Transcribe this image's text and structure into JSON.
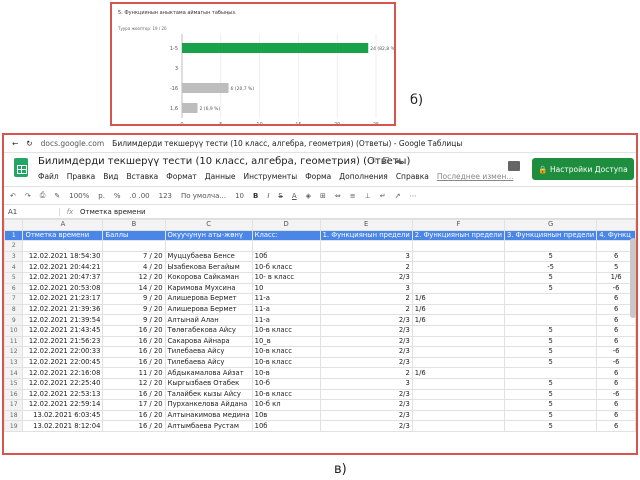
{
  "chart_panel": {
    "question": "5. Функциянын аныктама аймагын табыңыз.",
    "summary": "Туура жооптор: 19 / 20"
  },
  "chart_data": {
    "type": "bar",
    "orientation": "horizontal",
    "categories": [
      "1-5",
      "3",
      "-16",
      "1,6"
    ],
    "values": [
      24,
      0,
      6,
      2
    ],
    "data_labels": [
      "24 (82,8 %)",
      "",
      "6 (20,7 %)",
      "2 (6,9 %)"
    ],
    "xlim": [
      0,
      25
    ],
    "xticks": [
      "0",
      "5",
      "10",
      "15",
      "20",
      "25"
    ],
    "colors": {
      "correct": "#18a34a",
      "incorrect": "#bdbdbd"
    },
    "correct_index": 0
  },
  "captions": {
    "b": "б)",
    "v": "в)"
  },
  "browser": {
    "url": "docs.google.com",
    "tab_title": "Билимдерди текшерүү тести (10 класс, алгебра, геометрия) (Ответы) - Google Таблицы"
  },
  "doc": {
    "title": "Билимдерди текшерүү тести (10 класс, алгебра, геометрия) (Ответы)",
    "menus": [
      "Файл",
      "Правка",
      "Вид",
      "Вставка",
      "Формат",
      "Данные",
      "Инструменты",
      "Форма",
      "Дополнения",
      "Справка"
    ],
    "last_edit": "Последнее измен...",
    "share_label": "Настройки Доступа"
  },
  "toolbar": {
    "zoom": "100%",
    "currency": "р.",
    "percent": "%",
    "decimals": ".0  .00",
    "format": "123",
    "font": "По умолча...",
    "font_size": "10",
    "bold": "B",
    "italic": "I",
    "strike": "S",
    "text_color": "A"
  },
  "formula": {
    "cell_ref": "A1",
    "fx": "fx",
    "content": "Отметка времени"
  },
  "columns": [
    "A",
    "B",
    "C",
    "D",
    "E",
    "F",
    "G"
  ],
  "headers": [
    "Отметка времени",
    "Баллы",
    "Окуучунун аты-жөнү",
    "Класс:",
    "1. Функциянын предели",
    "2. Функциянын предели",
    "3. Функциянын предели",
    "4. Функц"
  ],
  "rows": [
    [
      "",
      "",
      "",
      "",
      "",
      "",
      "",
      ""
    ],
    [
      "12.02.2021 18:54:30",
      "7 / 20",
      "Муццубаева Бенсе",
      "10б",
      "3",
      "",
      "5",
      "6"
    ],
    [
      "12.02.2021 20:44:21",
      "4 / 20",
      "Ызабекова Бегайым",
      "10-б класс",
      "2",
      "",
      "-5",
      "5"
    ],
    [
      "12.02.2021 20:47:37",
      "12 / 20",
      "Кокорова Сайкаман",
      "10- в класс",
      "2/3",
      "",
      "5",
      "1/6"
    ],
    [
      "12.02.2021 20:53:08",
      "14 / 20",
      "Каримова Мухсина",
      "10",
      "3",
      "",
      "5",
      "-6"
    ],
    [
      "12.02.2021 21:23:17",
      "9 / 20",
      "Алишерова Бермет",
      "11-а",
      "2",
      "1/6",
      "",
      "6"
    ],
    [
      "12.02.2021 21:39:36",
      "9 / 20",
      "Алишерова Бермет",
      "11-а",
      "2",
      "1/6",
      "",
      "6"
    ],
    [
      "12.02.2021 21:39:54",
      "9 / 20",
      "Алтынай Алан",
      "11-а",
      "2/3",
      "1/6",
      "",
      "6"
    ],
    [
      "12.02.2021 21:43:45",
      "16 / 20",
      "Төлөгабекова Айсу",
      "10-в класс",
      "2/3",
      "",
      "5",
      "6"
    ],
    [
      "12.02.2021 21:56:23",
      "16 / 20",
      "Сакарова Айнара",
      "10_в",
      "2/3",
      "",
      "5",
      "6"
    ],
    [
      "12.02.2021 22:00:33",
      "16 / 20",
      "Тилебаева Айсу",
      "10-в класс",
      "2/3",
      "",
      "5",
      "-6"
    ],
    [
      "12.02.2021 22:00:45",
      "16 / 20",
      "Тилебаева Айсу",
      "10-в класс",
      "2/3",
      "",
      "5",
      "-6"
    ],
    [
      "12.02.2021 22:16:08",
      "11 / 20",
      "Абдыкамалова Айзат",
      "10-в",
      "2",
      "1/6",
      "",
      "6"
    ],
    [
      "12.02.2021 22:25:40",
      "12 / 20",
      "Кыргызбаев Отабек",
      "10-б",
      "3",
      "",
      "5",
      "6"
    ],
    [
      "12.02.2021 22:53:13",
      "16 / 20",
      "Талайбек кызы Айсу",
      "10-в класс",
      "2/3",
      "",
      "5",
      "-6"
    ],
    [
      "12.02.2021 22:59:14",
      "17 / 20",
      "Пурханкелова Айдана",
      "10-б кл",
      "2/3",
      "",
      "5",
      "6"
    ],
    [
      "13.02.2021 6:03:45",
      "16 / 20",
      "Алтынакимова медина",
      "10в",
      "2/3",
      "",
      "5",
      "6"
    ],
    [
      "13.02.2021 8:12:04",
      "16 / 20",
      "Алтымбаева Рустам",
      "10б",
      "2/3",
      "",
      "5",
      "6"
    ]
  ]
}
